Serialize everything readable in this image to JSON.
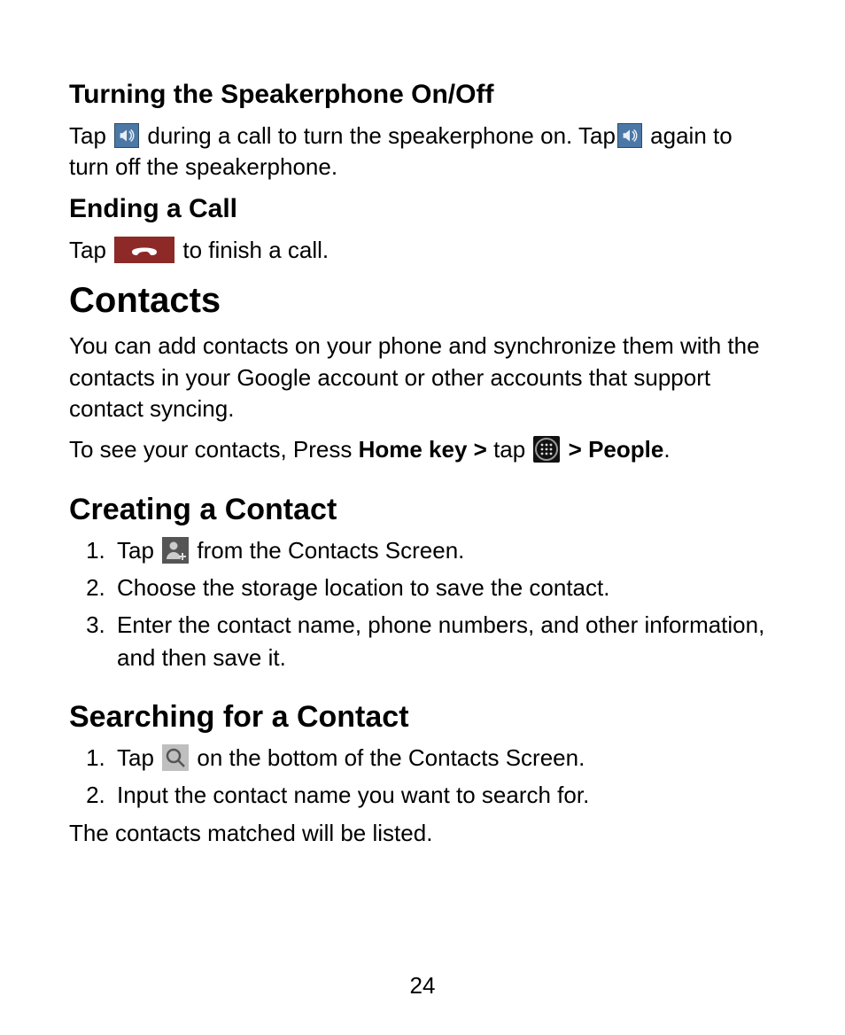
{
  "section1": {
    "heading": "Turning the Speakerphone On/Off",
    "p1_a": "Tap ",
    "p1_b": " during a call to turn the speakerphone on. Tap",
    "p1_c": " again to turn off the speakerphone."
  },
  "section2": {
    "heading": "Ending a Call",
    "p1_a": "Tap ",
    "p1_b": " to finish a call."
  },
  "section3": {
    "heading": "Contacts",
    "p1": "You can add contacts on your phone and synchronize them with the contacts in your Google account or other accounts that support contact syncing.",
    "p2_a": "To see your contacts, Press ",
    "p2_bold1": "Home key > ",
    "p2_b": "tap ",
    "p2_bold2": " > People",
    "p2_c": "."
  },
  "section4": {
    "heading": "Creating a Contact",
    "step1_a": "Tap ",
    "step1_b": " from the Contacts Screen.",
    "step2": "Choose the storage location to save the contact.",
    "step3": "Enter the contact name, phone numbers, and other information, and then save it."
  },
  "section5": {
    "heading": "Searching for a Contact",
    "step1_a": "Tap ",
    "step1_b": " on the bottom of the Contacts Screen.",
    "step2": "Input the contact name you want to search for.",
    "p_after": "The contacts matched will be listed."
  },
  "page_number": "24"
}
